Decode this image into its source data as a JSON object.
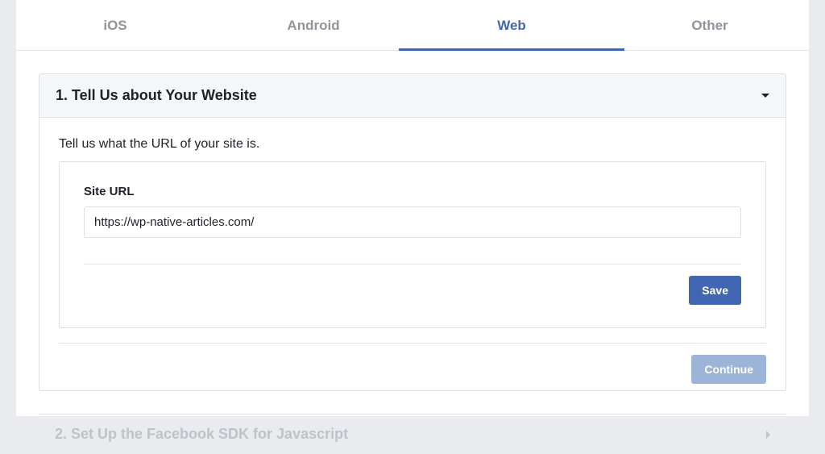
{
  "tabs": [
    {
      "label": "iOS",
      "active": false
    },
    {
      "label": "Android",
      "active": false
    },
    {
      "label": "Web",
      "active": true
    },
    {
      "label": "Other",
      "active": false
    }
  ],
  "panel1": {
    "title": "1. Tell Us about Your Website",
    "prompt": "Tell us what the URL of your site is.",
    "field_label": "Site URL",
    "site_url": "https://wp-native-articles.com/",
    "save_label": "Save",
    "continue_label": "Continue"
  },
  "panel2": {
    "title": "2. Set Up the Facebook SDK for Javascript"
  }
}
